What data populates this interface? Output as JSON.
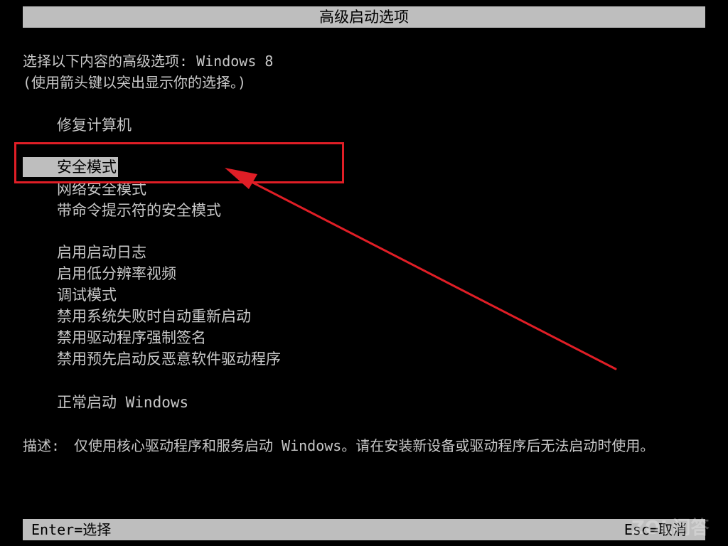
{
  "header": {
    "title": "高级启动选项"
  },
  "prompt": {
    "line1": "选择以下内容的高级选项: Windows 8",
    "line2": "(使用箭头键以突出显示你的选择。)"
  },
  "menu": {
    "items": [
      {
        "label": "修复计算机"
      },
      {
        "label": "安全模式"
      },
      {
        "label": "网络安全模式"
      },
      {
        "label": "带命令提示符的安全模式"
      },
      {
        "label": "启用启动日志"
      },
      {
        "label": "启用低分辨率视频"
      },
      {
        "label": "调试模式"
      },
      {
        "label": "禁用系统失败时自动重新启动"
      },
      {
        "label": "禁用驱动程序强制签名"
      },
      {
        "label": "禁用预先启动反恶意软件驱动程序"
      },
      {
        "label": "正常启动 Windows"
      }
    ],
    "selected_index": 1
  },
  "description": {
    "label": "描述:",
    "text": "仅使用核心驱动程序和服务启动 Windows。请在安装新设备或驱动程序后无法启动时使用。"
  },
  "footer": {
    "enter_hint": "Enter=选择",
    "esc_hint": "Esc=取消"
  },
  "watermark": {
    "text": "ZOL问答"
  },
  "annotation": {
    "color": "#e01e26"
  },
  "colors": {
    "background": "#000000",
    "bar": "#bebebe",
    "text": "#c8c8c8"
  }
}
